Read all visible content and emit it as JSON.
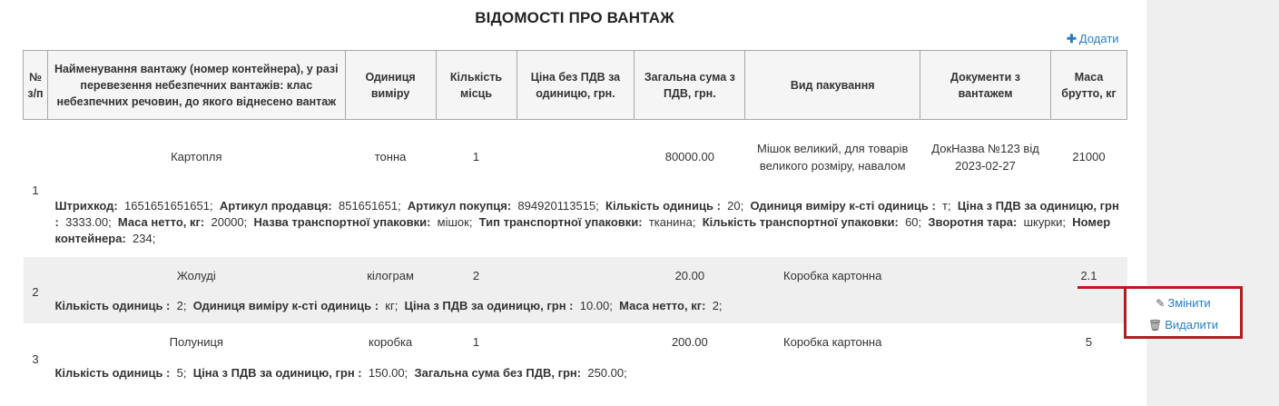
{
  "title": "ВІДОМОСТІ ПРО ВАНТАЖ",
  "add_label": "Додати",
  "columns": [
    "№ з/п",
    "Найменування вантажу (номер контейнера), у разі перевезення небезпечних вантажів: клас небезпечних речовин, до якого віднесено вантаж",
    "Одиниця виміру",
    "Кількість місць",
    "Ціна без ПДВ за одиницю, грн.",
    "Загальна сума з ПДВ, грн.",
    "Вид пакування",
    "Документи з вантажем",
    "Маса брутто, кг"
  ],
  "rows": [
    {
      "num": "1",
      "name": "Картопля",
      "unit": "тонна",
      "places": "1",
      "price": "",
      "total": "80000.00",
      "packaging": "Мішок великий, для товарів великого розміру, навалом",
      "docs": "ДокНазва №123 від 2023-02-27",
      "mass": "21000",
      "details": [
        {
          "label": "Штрихкод:",
          "value": "1651651651651"
        },
        {
          "label": "Артикул продавця:",
          "value": "851651651"
        },
        {
          "label": "Артикул покупця:",
          "value": "894920113515"
        },
        {
          "label": "Кількість одиниць :",
          "value": "20"
        },
        {
          "label": "Одиниця виміру к-сті одиниць :",
          "value": "т"
        },
        {
          "label": "Ціна з ПДВ за одиницю, грн :",
          "value": "3333.00"
        },
        {
          "label": "Маса нетто, кг:",
          "value": "20000"
        },
        {
          "label": "Назва транспортної упаковки:",
          "value": "мішок"
        },
        {
          "label": "Тип транспортної упаковки:",
          "value": "тканина"
        },
        {
          "label": "Кількість транспортної упаковки:",
          "value": "60"
        },
        {
          "label": "Зворотня тара:",
          "value": "шкурки"
        },
        {
          "label": "Номер контейнера:",
          "value": "234"
        }
      ]
    },
    {
      "num": "2",
      "name": "Жолуді",
      "unit": "кілограм",
      "places": "2",
      "price": "",
      "total": "20.00",
      "packaging": "Коробка картонна",
      "docs": "",
      "mass": "2.1",
      "details": [
        {
          "label": "Кількість одиниць :",
          "value": "2"
        },
        {
          "label": "Одиниця виміру к-сті одиниць :",
          "value": "кг"
        },
        {
          "label": "Ціна з ПДВ за одиницю, грн :",
          "value": "10.00"
        },
        {
          "label": "Маса нетто, кг:",
          "value": "2"
        }
      ]
    },
    {
      "num": "3",
      "name": "Полуниця",
      "unit": "коробка",
      "places": "1",
      "price": "",
      "total": "200.00",
      "packaging": "Коробка картонна",
      "docs": "",
      "mass": "5",
      "details": [
        {
          "label": "Кількість одиниць :",
          "value": "5"
        },
        {
          "label": "Ціна з ПДВ за одиницю, грн :",
          "value": "150.00"
        },
        {
          "label": "Загальна сума без ПДВ, грн:",
          "value": "250.00"
        }
      ]
    }
  ],
  "actions": {
    "edit_label": "Змінити",
    "delete_label": "Видалити"
  },
  "colors": {
    "link": "#2b7ec1",
    "highlight_border": "#b51c22",
    "row_alt": "#efefef"
  }
}
